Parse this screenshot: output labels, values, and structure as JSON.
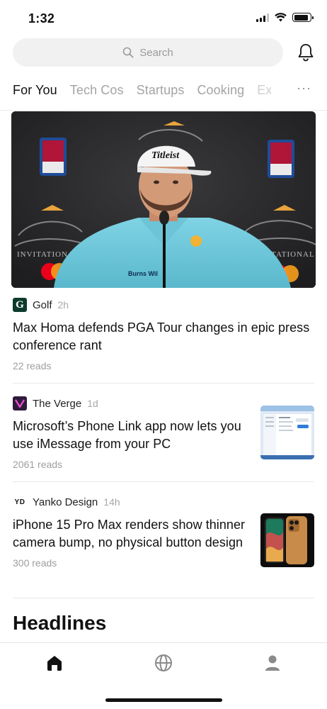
{
  "status_bar": {
    "time": "1:32"
  },
  "search": {
    "placeholder": "Search"
  },
  "tabs": [
    "For You",
    "Tech Cos",
    "Startups",
    "Cooking",
    "Ex"
  ],
  "tabs_more": "···",
  "hero": {
    "cap_logo_text": "Titleist",
    "shirt_sponsor_text": "Burns Wil",
    "backdrop_text": "INVITATIONAL"
  },
  "articles": [
    {
      "source": "Golf",
      "source_logo": "G",
      "time": "2h",
      "headline": "Max Homa defends PGA Tour changes in epic press conference rant",
      "reads": "22 reads"
    },
    {
      "source": "The Verge",
      "source_logo": "verge-logo-icon",
      "time": "1d",
      "headline": "Microsoft’s Phone Link app now lets you use iMessage from your PC",
      "reads": "2061 reads"
    },
    {
      "source": "Yanko Design",
      "source_logo": "YD",
      "time": "14h",
      "headline": "iPhone 15 Pro Max renders show thinner camera bump, no physical button design",
      "reads": "300 reads"
    }
  ],
  "section": {
    "headlines_title": "Headlines"
  },
  "bottom_nav": [
    "home-icon",
    "globe-icon",
    "profile-icon"
  ],
  "colors": {
    "accent_text": "#111111",
    "muted_text": "#a4a4a4",
    "search_bg": "#f1f1f1"
  }
}
